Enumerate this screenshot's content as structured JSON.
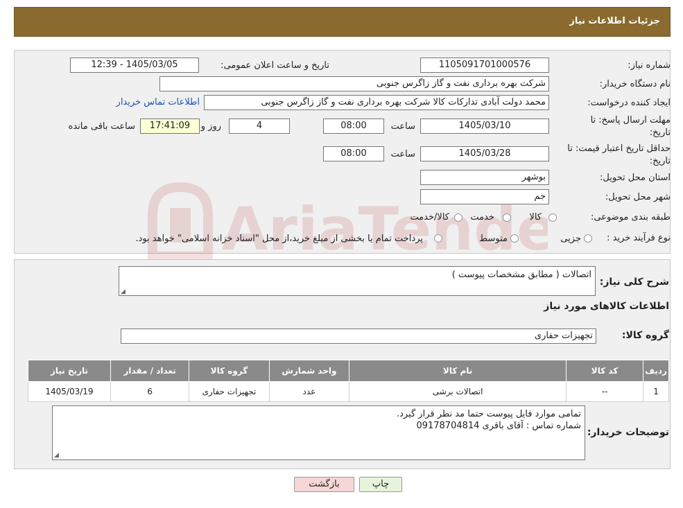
{
  "header": {
    "title": "جزئیات اطلاعات نیاز"
  },
  "form": {
    "need_number_label": "شماره نیاز:",
    "need_number": "1105091701000576",
    "announce_label": "تاریخ و ساعت اعلان عمومی:",
    "announce_value": "1405/03/05 - 12:39",
    "buyer_org_label": "نام دستگاه خریدار:",
    "buyer_org": "شرکت بهره برداری نفت و گاز زاگرس جنوبی",
    "requester_label": "ایجاد کننده درخواست:",
    "requester": "محمد دولت آبادی تدارکات کالا شرکت بهره برداری نفت و گاز زاگرس جنوبی",
    "contact_link": "اطلاعات تماس خریدار",
    "deadline_label_1": "مهلت ارسال پاسخ: تا",
    "deadline_label_2": "تاریخ:",
    "deadline_date": "1405/03/10",
    "hour_label": "ساعت",
    "deadline_time": "08:00",
    "days_value": "4",
    "days_label": "روز و",
    "remaining_time": "17:41:09",
    "remaining_label": "ساعت باقی مانده",
    "validity_label_1": "حداقل تاریخ اعتبار قیمت: تا",
    "validity_label_2": "تاریخ:",
    "validity_date": "1405/03/28",
    "validity_time": "08:00",
    "province_label": "استان محل تحویل:",
    "province": "بوشهر",
    "city_label": "شهر محل تحویل:",
    "city": "جم",
    "category_label": "طبقه بندی موضوعی:",
    "category_options": [
      "کالا",
      "خدمت",
      "کالا/خدمت"
    ],
    "process_label": "نوع فرآیند خرید :",
    "process_options": [
      "جزیی",
      "متوسط"
    ],
    "process_note": "پرداخت تمام یا بخشی از مبلغ خرید،از محل \"اسناد خزانه اسلامی\" خواهد بود."
  },
  "details": {
    "summary_label": "شرح کلی نیاز:",
    "summary": "اتصالات ( مطابق مشخصات  پیوست  )",
    "goods_info_title": "اطلاعات کالاهای مورد نیاز",
    "goods_group_label": "گروه کالا:",
    "goods_group": "تجهیزات حفاری",
    "table": {
      "headers": [
        "ردیف",
        "کد کالا",
        "نام کالا",
        "واحد شمارش",
        "گروه کالا",
        "تعداد / مقدار",
        "تاریخ نیاز"
      ],
      "rows": [
        [
          "1",
          "--",
          "اتصالات برشی",
          "عدد",
          "تجهیزات حفاری",
          "6",
          "1405/03/19"
        ]
      ]
    },
    "buyer_notes_label": "توضیحات خریدار:",
    "buyer_notes_line1": "تمامی موارد فایل پیوست حتما مد نظر قرار گیرد.",
    "buyer_notes_line2": "شماره تماس : آقای باقری 09178704814"
  },
  "buttons": {
    "print": "چاپ",
    "back": "بازگشت"
  },
  "watermark": {
    "text": "AriaTender.neT"
  },
  "colors": {
    "header": "#8a6a2e",
    "table_header": "#8a8a8a",
    "back_button": "#f7d6d6",
    "print_button": "#e6f4dc"
  }
}
